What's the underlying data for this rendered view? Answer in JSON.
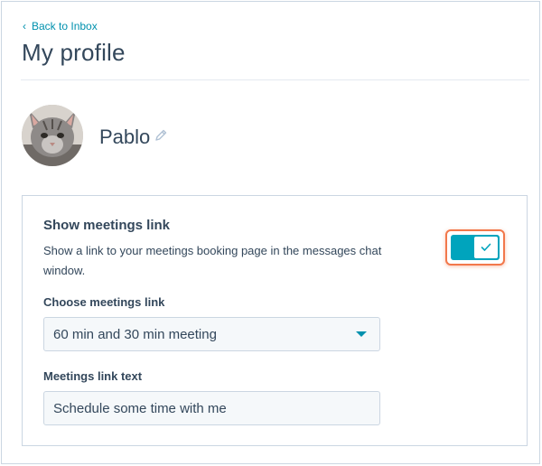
{
  "nav": {
    "back_label": "Back to Inbox"
  },
  "page": {
    "title": "My profile"
  },
  "profile": {
    "name": "Pablo"
  },
  "meetings": {
    "title": "Show meetings link",
    "description": "Show a link to your meetings booking page in the messages chat window.",
    "toggle_on": true,
    "choose_label": "Choose meetings link",
    "selected_link": "60 min and 30 min meeting",
    "link_text_label": "Meetings link text",
    "link_text_value": "Schedule some time with me"
  },
  "colors": {
    "accent": "#00a4bd",
    "link": "#0091ae",
    "highlight": "#f2784b"
  }
}
